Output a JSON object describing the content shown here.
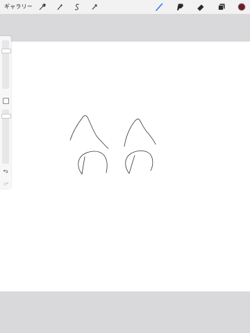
{
  "toolbar": {
    "gallery_label": "ギャラリー",
    "left_tools": [
      {
        "name": "wrench-icon"
      },
      {
        "name": "magic-wand-icon"
      },
      {
        "name": "selection-icon"
      },
      {
        "name": "transform-arrow-icon"
      }
    ],
    "right_tools": [
      {
        "name": "brush-icon",
        "active": true
      },
      {
        "name": "smudge-icon"
      },
      {
        "name": "eraser-icon"
      },
      {
        "name": "layers-icon"
      }
    ],
    "color_swatch": "#6b1f24",
    "accent": "#2f7cf6"
  },
  "sidebar": {
    "size_slider_value": 0.15,
    "opacity_slider_value": 0.08,
    "undo_icon": "undo-icon",
    "redo_icon": "redo-icon",
    "modify_icon": "modify-square-icon"
  },
  "canvas": {
    "background": "#ffffff",
    "stroke_color": "#333333"
  }
}
